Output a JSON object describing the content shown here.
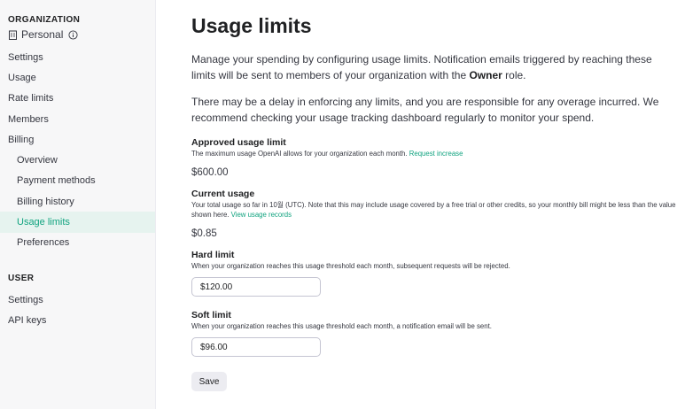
{
  "sidebar": {
    "org_section_label": "ORGANIZATION",
    "org_name": "Personal",
    "org_items": [
      {
        "label": "Settings"
      },
      {
        "label": "Usage"
      },
      {
        "label": "Rate limits"
      },
      {
        "label": "Members"
      },
      {
        "label": "Billing"
      }
    ],
    "billing_items": [
      {
        "label": "Overview"
      },
      {
        "label": "Payment methods"
      },
      {
        "label": "Billing history"
      },
      {
        "label": "Usage limits",
        "active": true
      },
      {
        "label": "Preferences"
      }
    ],
    "user_section_label": "USER",
    "user_items": [
      {
        "label": "Settings"
      },
      {
        "label": "API keys"
      }
    ]
  },
  "main": {
    "title": "Usage limits",
    "desc1_pre": "Manage your spending by configuring usage limits. Notification emails triggered by reaching these limits will be sent to members of your organization with the ",
    "desc1_bold": "Owner",
    "desc1_post": " role.",
    "desc2": "There may be a delay in enforcing any limits, and you are responsible for any overage incurred. We recommend checking your usage tracking dashboard regularly to monitor your spend.",
    "approved": {
      "title": "Approved usage limit",
      "desc": "The maximum usage OpenAI allows for your organization each month. ",
      "link": "Request increase",
      "value": "$600.00"
    },
    "current": {
      "title": "Current usage",
      "desc": "Your total usage so far in 10월 (UTC). Note that this may include usage covered by a free trial or other credits, so your monthly bill might be less than the value shown here. ",
      "link": "View usage records",
      "value": "$0.85"
    },
    "hard": {
      "title": "Hard limit",
      "desc": "When your organization reaches this usage threshold each month, subsequent requests will be rejected.",
      "value": "$120.00"
    },
    "soft": {
      "title": "Soft limit",
      "desc": "When your organization reaches this usage threshold each month, a notification email will be sent.",
      "value": "$96.00"
    },
    "save_label": "Save"
  },
  "colors": {
    "accent": "#10a37f",
    "active_bg": "#e6f3ef",
    "sidebar_bg": "#f7f7f8"
  }
}
